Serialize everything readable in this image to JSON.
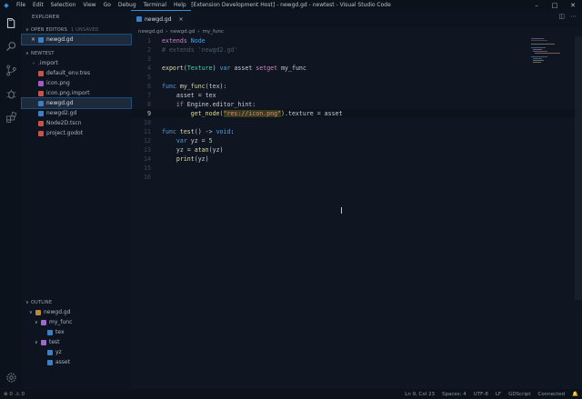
{
  "window": {
    "title": "[Extension Development Host] - newgd.gd - newtest - Visual Studio Code",
    "menu": [
      "File",
      "Edit",
      "Selection",
      "View",
      "Go",
      "Debug",
      "Terminal",
      "Help"
    ],
    "app_icon": "vscode-icon"
  },
  "sidebar": {
    "header": "EXPLORER",
    "open_editors": {
      "title": "OPEN EDITORS",
      "unsaved": "1 UNSAVED",
      "items": [
        {
          "label": "newgd.gd",
          "close": "×"
        }
      ]
    },
    "project": {
      "title": "NEWTEST",
      "files": [
        {
          "label": ".import",
          "icon": "folder-icon"
        },
        {
          "label": "default_env.tres",
          "icon": "file-icon"
        },
        {
          "label": "icon.png",
          "icon": "image-icon"
        },
        {
          "label": "icon.png.import",
          "icon": "file-icon"
        },
        {
          "label": "newgd.gd",
          "icon": "gdscript-icon"
        },
        {
          "label": "newgd2.gd",
          "icon": "gdscript-icon"
        },
        {
          "label": "Node2D.tscn",
          "icon": "scene-icon"
        },
        {
          "label": "project.godot",
          "icon": "godot-icon"
        }
      ]
    },
    "outline": {
      "title": "OUTLINE",
      "items": [
        {
          "label": "newgd.gd",
          "icon": "file-symbol-icon",
          "chev": "∨"
        },
        {
          "label": "my_func",
          "icon": "method-icon",
          "chev": "∨"
        },
        {
          "label": "tex",
          "icon": "variable-icon",
          "chev": ""
        },
        {
          "label": "test",
          "icon": "method-icon",
          "chev": "∨"
        },
        {
          "label": "yz",
          "icon": "variable-icon",
          "chev": ""
        },
        {
          "label": "asset",
          "icon": "variable-icon",
          "chev": ""
        }
      ]
    }
  },
  "editor": {
    "tab": {
      "label": "newgd.gd",
      "close": "×"
    },
    "breadcrumb": [
      "newgd.gd",
      "newgd.gd",
      "my_func"
    ],
    "line_numbers": [
      "1",
      "2",
      "3",
      "4",
      "5",
      "6",
      "7",
      "8",
      "9",
      "10",
      "11",
      "12",
      "13",
      "14",
      "15",
      "16"
    ],
    "current_line": "9",
    "code": {
      "l1_kw": "extends",
      "l1_rest": " Node",
      "l2": "# extends 'newgd2.gd'",
      "l4_fn": "export",
      "l4_p1": "(",
      "l4_ty": "Texture",
      "l4_p2": ") ",
      "l4_var": "var",
      "l4_rest1": " asset ",
      "l4_sg": "setget",
      "l4_rest2": " my_func",
      "l6_kw": "func",
      "l6_rest": " ",
      "l6_fn": "my_func",
      "l6_rest2": "(tex):",
      "l7": "    asset = tex",
      "l8_kw": "    if",
      "l8_rest": " Engine.editor_hint:",
      "l9_fn": "        get_node",
      "l9_p": "(",
      "l9_str": "\"res://icon.png\"",
      "l9_rest": ").texture = asset",
      "l11_kw": "func",
      "l11_fn": " test",
      "l11_rest": "() -> ",
      "l11_void": "void",
      "l11_end": ":",
      "l12_kw": "    var",
      "l12_rest": " yz = ",
      "l12_num": "5",
      "l13_rest": "    yz = ",
      "l13_fn": "atan",
      "l13_rest2": "(yz)",
      "l14_fn": "    print",
      "l14_rest": "(yz)"
    }
  },
  "statusbar": {
    "left": [
      "⊗ 0",
      "⚠ 0"
    ],
    "right": [
      "Ln 9, Col 23",
      "Spaces: 4",
      "UTF-8",
      "LF",
      "GDScript",
      "Connected"
    ]
  },
  "colors": {
    "accent": "#2f8fdd",
    "background": "#0f1622",
    "sidebar": "#0d141f"
  }
}
